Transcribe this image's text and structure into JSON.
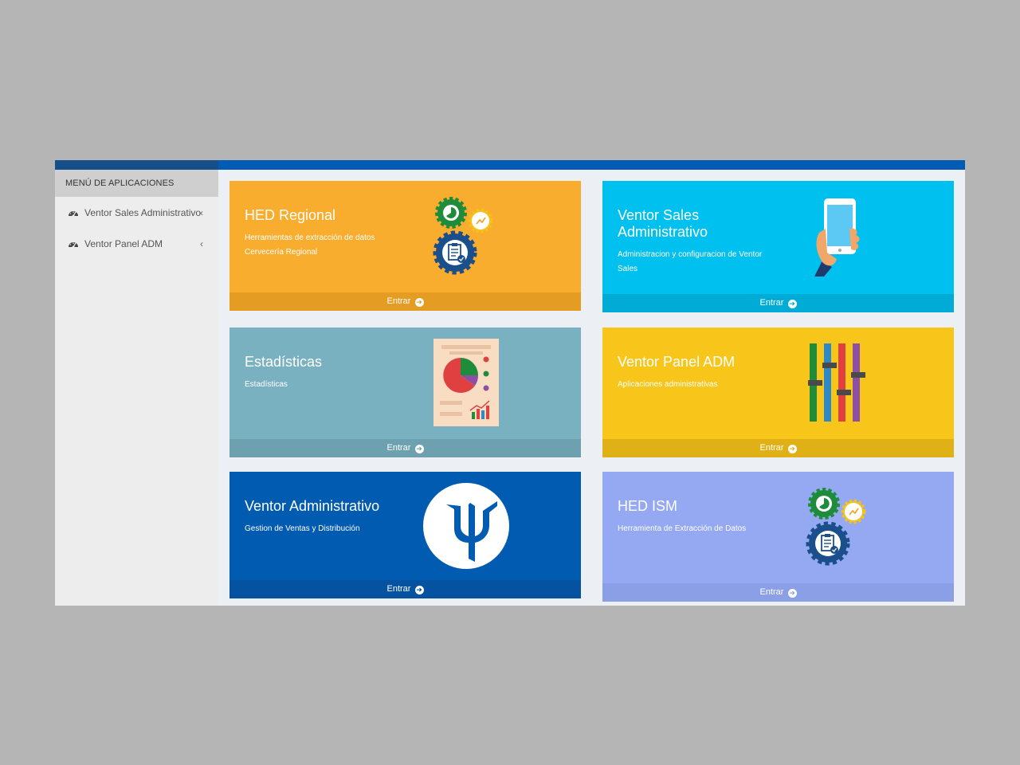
{
  "sidebar": {
    "header": "MENÚ DE APLICACIONES",
    "items": [
      {
        "label": "Ventor Sales Administrativo",
        "icon": "dashboard-icon"
      },
      {
        "label": "Ventor Panel ADM",
        "icon": "dashboard-icon"
      }
    ]
  },
  "cards": [
    {
      "title": "HED Regional",
      "desc_lines": [
        "Herramientas de extracción de datos",
        "Cervecería Regional"
      ],
      "action": "Entrar",
      "illustration": "gears-report-icon",
      "color": "#f9ad2e"
    },
    {
      "title_lines": [
        "Ventor Sales",
        "Administrativo"
      ],
      "desc_lines": [
        "Administracion y configuracion de Ventor",
        "Sales"
      ],
      "action": "Entrar",
      "illustration": "hand-phone-icon",
      "color": "#00c0ef"
    },
    {
      "title": "Estadísticas",
      "desc_lines": [
        "Estadísticas"
      ],
      "action": "Entrar",
      "illustration": "pie-chart-report-icon",
      "color": "#7ab1c1"
    },
    {
      "title": "Ventor Panel ADM",
      "desc_lines": [
        "Aplicaciones administrativas"
      ],
      "action": "Entrar",
      "illustration": "sliders-icon",
      "color": "#f8c51b"
    },
    {
      "title": "Ventor Administrativo",
      "desc_lines": [
        "Gestion de Ventas y Distribución"
      ],
      "action": "Entrar",
      "illustration": "trident-logo-icon",
      "color": "#005bb1"
    },
    {
      "title": "HED ISM",
      "desc_lines": [
        "Herramienta de Extracción de Datos"
      ],
      "action": "Entrar",
      "illustration": "gears-report-icon",
      "color": "#94a9f2"
    }
  ],
  "colors": {
    "topbar": "#005bb5",
    "background": "#ecf0f5"
  }
}
